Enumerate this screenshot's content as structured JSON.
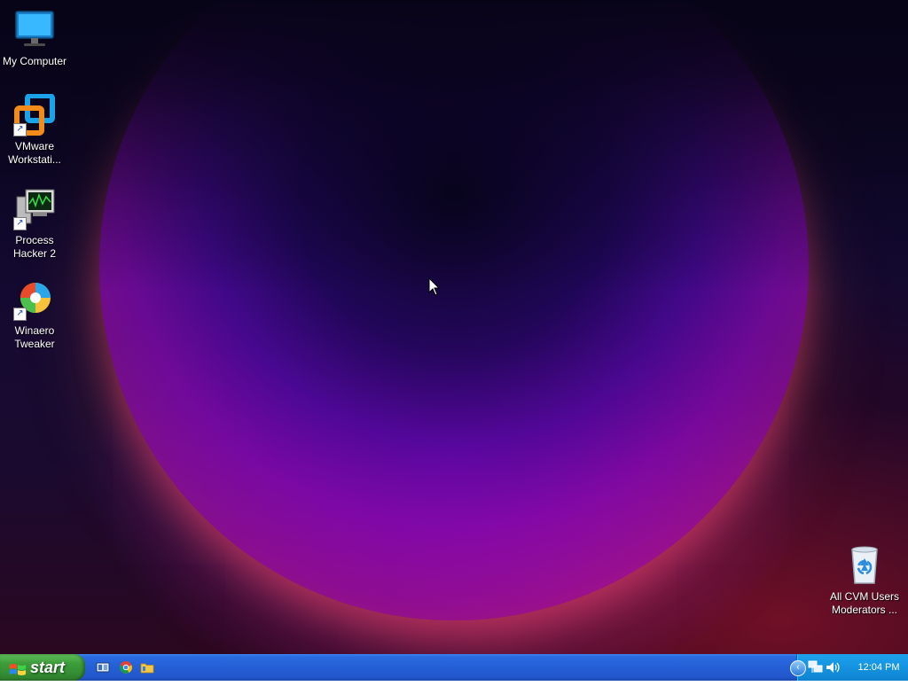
{
  "desktop": {
    "icons": [
      {
        "label": "My Computer",
        "icon": "monitor-icon"
      },
      {
        "label": "VMware Workstati...",
        "icon": "vmware-icon"
      },
      {
        "label": "Process Hacker 2",
        "icon": "process-hacker-icon"
      },
      {
        "label": "Winaero Tweaker",
        "icon": "winaero-icon"
      },
      {
        "label": "All CVM Users Moderators ...",
        "icon": "recycle-bin-icon"
      }
    ]
  },
  "taskbar": {
    "start_label": "start",
    "quick_launch": [
      "show-desktop-icon",
      "chrome-icon",
      "folder-icon"
    ],
    "tray": {
      "chevron": "‹",
      "clock": "12:04 PM",
      "icons": [
        "network-icon",
        "volume-icon"
      ]
    }
  },
  "colors": {
    "taskbar_blue": "#245ed6",
    "start_green": "#3c9d3a",
    "tray_blue": "#1493e0"
  }
}
